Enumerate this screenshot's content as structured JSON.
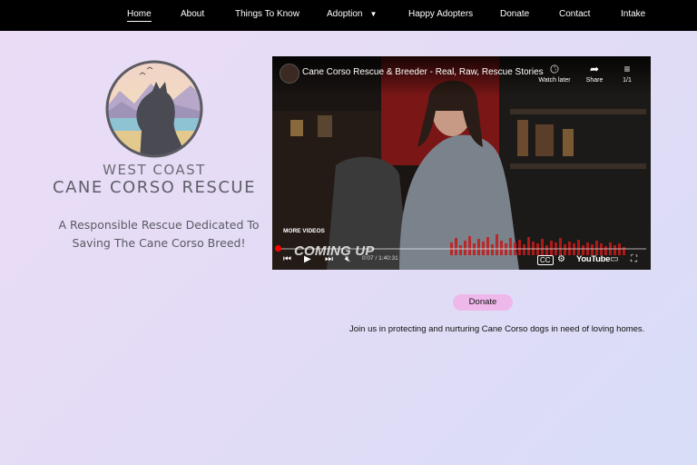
{
  "nav": {
    "items": [
      {
        "label": "Home",
        "active": true
      },
      {
        "label": "About"
      },
      {
        "label": "Things To Know"
      },
      {
        "label": "Adoption",
        "has_dropdown": true
      },
      {
        "label": "Happy Adopters"
      },
      {
        "label": "Donate"
      },
      {
        "label": "Contact"
      },
      {
        "label": "Intake"
      }
    ]
  },
  "brand": {
    "line1": "WEST COAST",
    "line2": "CANE CORSO RESCUE",
    "tagline_line1": "A Responsible Rescue Dedicated To",
    "tagline_line2": "Saving The Cane Corso Breed!",
    "logo_icon": "dog-silhouette-logo"
  },
  "video": {
    "title": "Cane Corso Rescue & Breeder - Real, Raw, Rescue Stories",
    "actions": [
      {
        "icon": "clock-icon",
        "label": "Watch later"
      },
      {
        "icon": "share-icon",
        "label": "Share"
      },
      {
        "icon": "playlist-icon",
        "label": "1/1"
      }
    ],
    "more_videos": "MORE VIDEOS",
    "overlay_text": "COMING UP",
    "time_current": "0:07",
    "time_total": "1:40:31",
    "time_separator": " / ",
    "brand": "YouTube",
    "progress": 0.001
  },
  "main": {
    "donate_label": "Donate",
    "description": "Join us in protecting and nurturing Cane Corso dogs in need of loving homes."
  },
  "colors": {
    "nav_bg": "#000000",
    "donate_bg": "#efb8ea",
    "progress_red": "#ff0000"
  }
}
